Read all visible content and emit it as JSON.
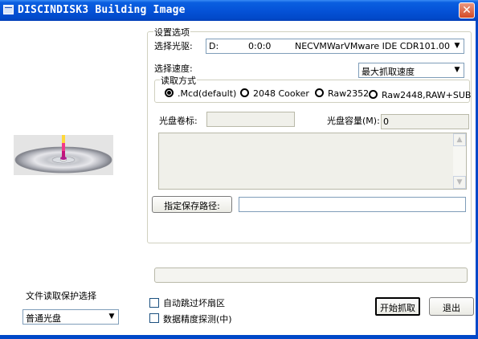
{
  "window": {
    "title": "DISCINDISK3 Building Image",
    "close_glyph": "✕"
  },
  "settings_group": {
    "title": "设置选项",
    "drive_label": "选择光驱:",
    "drive": {
      "letter": "D:",
      "address": "0:0:0",
      "model": "NECVMWarVMware IDE CDR101.00"
    },
    "speed_label": "选择速度:",
    "speed_value": "最大抓取速度"
  },
  "read_mode": {
    "title": "读取方式",
    "options": [
      {
        "label": ".Mcd(default)",
        "checked": true
      },
      {
        "label": "2048 Cooker",
        "checked": false
      },
      {
        "label": "Raw2352",
        "checked": false
      },
      {
        "label": "Raw2448,RAW+SUB",
        "checked": false
      }
    ]
  },
  "disc_info": {
    "volume_label": "光盘卷标:",
    "volume_value": "",
    "capacity_label": "光盘容量(M):",
    "capacity_value": "0"
  },
  "log_area": {
    "text": ""
  },
  "save_path": {
    "button_label": "指定保存路径:",
    "value": ""
  },
  "progress": {
    "value": 0
  },
  "protection": {
    "label": "文件读取保护选择",
    "selected": "普通光盘"
  },
  "options": {
    "skip_bad_sectors": {
      "label": "自动跳过坏扇区",
      "checked": false
    },
    "precision_detect": {
      "label": "数据精度探测(中)",
      "checked": false
    }
  },
  "actions": {
    "start_label": "开始抓取",
    "exit_label": "退出"
  },
  "icons": {
    "dropdown": "chevron-down-icon",
    "close": "close-icon",
    "disc": "cd-disc-icon"
  },
  "colors": {
    "titlebar": "#0553d8",
    "frame": "#0148c8",
    "close_button": "#d44a25"
  }
}
